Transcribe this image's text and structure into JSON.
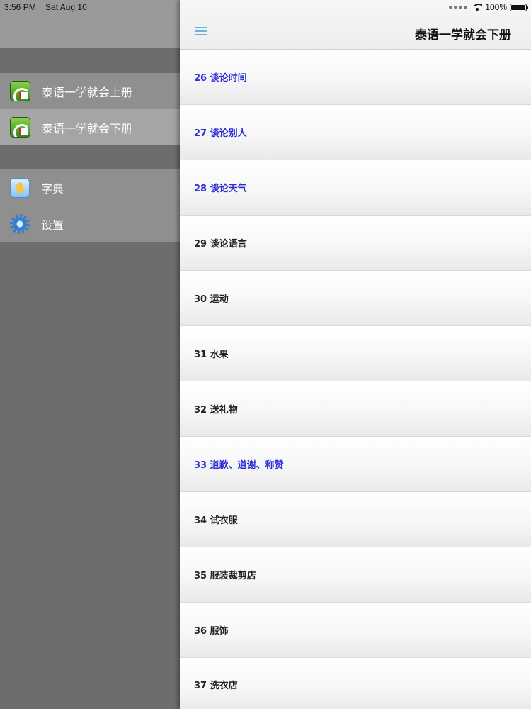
{
  "status_bar": {
    "time": "3:56 PM",
    "date": "Sat Aug 10",
    "battery": "100%"
  },
  "sidebar": {
    "books": [
      {
        "label": "泰语一学就会上册",
        "icon": "book-icon"
      },
      {
        "label": "泰语一学就会下册",
        "icon": "book-icon",
        "selected": true
      }
    ],
    "tools": [
      {
        "label": "字典",
        "icon": "dictionary-icon"
      },
      {
        "label": "设置",
        "icon": "gear-icon"
      }
    ]
  },
  "navbar": {
    "menu_icon": "menu-icon",
    "title": "泰语一学就会下册"
  },
  "lessons": [
    {
      "label": "26 谈论时间",
      "highlight": true
    },
    {
      "label": "27 谈论别人",
      "highlight": true
    },
    {
      "label": "28 谈论天气",
      "highlight": true
    },
    {
      "label": "29 谈论语言",
      "highlight": false
    },
    {
      "label": "30 运动",
      "highlight": false
    },
    {
      "label": "31 水果",
      "highlight": false
    },
    {
      "label": "32 送礼物",
      "highlight": false
    },
    {
      "label": "33 道歉、道谢、称赞",
      "highlight": true
    },
    {
      "label": "34 试衣服",
      "highlight": false
    },
    {
      "label": "35 服装裁剪店",
      "highlight": false
    },
    {
      "label": "36 服饰",
      "highlight": false
    },
    {
      "label": "37 洗衣店",
      "highlight": false
    }
  ],
  "colors": {
    "highlight_text": "#2c2fd9",
    "sidebar_bg": "#6d6d6d",
    "menu_icon": "#69b4df"
  }
}
